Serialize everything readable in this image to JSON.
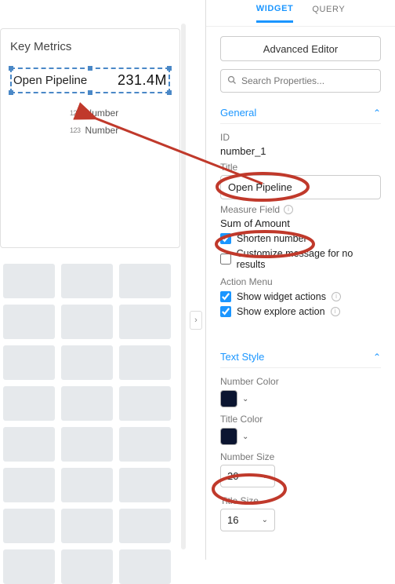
{
  "canvas": {
    "card_title": "Key Metrics",
    "selected": {
      "title": "Open Pipeline",
      "value": "231.4M"
    },
    "sub_label": "Number",
    "icon123": "123"
  },
  "panel": {
    "tabs": {
      "widget": "WIDGET",
      "query": "QUERY"
    },
    "advanced_btn": "Advanced Editor",
    "search_placeholder": "Search Properties...",
    "sections": {
      "general": {
        "label": "General",
        "id_label": "ID",
        "id_value": "number_1",
        "title_label": "Title",
        "title_value": "Open Pipeline",
        "measure_label": "Measure Field",
        "measure_value": "Sum of Amount",
        "shorten_label": "Shorten number",
        "customize_label": "Customize message for no results",
        "action_menu_label": "Action Menu",
        "show_widget_actions": "Show widget actions",
        "show_explore_action": "Show explore action"
      },
      "text_style": {
        "label": "Text Style",
        "number_color_label": "Number Color",
        "number_color": "#0b1530",
        "title_color_label": "Title Color",
        "title_color": "#0b1530",
        "number_size_label": "Number Size",
        "number_size_value": "20",
        "title_size_label": "Title Size",
        "title_size_value": "16"
      }
    }
  },
  "annot": {
    "stroke": "#c0392b"
  }
}
